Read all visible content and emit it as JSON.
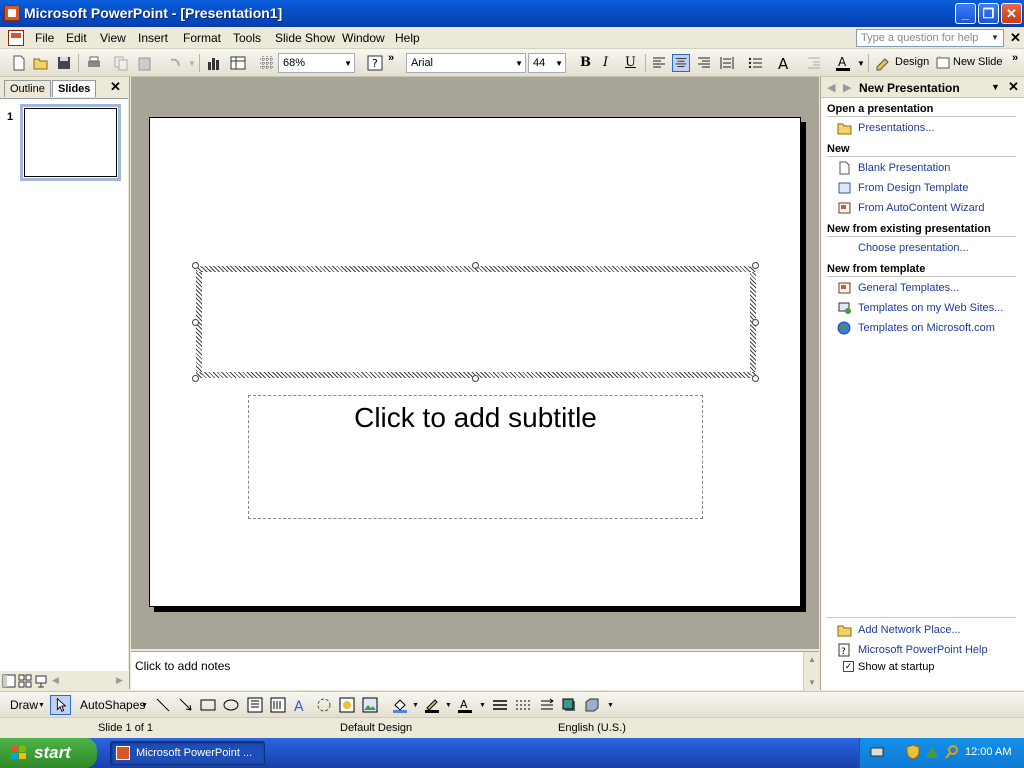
{
  "window": {
    "title": "Microsoft PowerPoint - [Presentation1]"
  },
  "menu": {
    "items": [
      "File",
      "Edit",
      "View",
      "Insert",
      "Format",
      "Tools",
      "Slide Show",
      "Window",
      "Help"
    ],
    "help_placeholder": "Type a question for help"
  },
  "toolbar": {
    "zoom": "68%",
    "font": "Arial",
    "font_size": "44",
    "bold": "B",
    "italic": "I",
    "underline": "U",
    "design_label": "Design",
    "new_slide_label": "New Slide"
  },
  "left_pane": {
    "tabs": [
      "Outline",
      "Slides"
    ],
    "active_tab": "Slides",
    "slide_number": "1"
  },
  "slide": {
    "subtitle_placeholder": "Click to add subtitle"
  },
  "notes": {
    "placeholder": "Click to add notes"
  },
  "task_pane": {
    "title": "New Presentation",
    "sections": {
      "open": {
        "heading": "Open a presentation",
        "links": [
          "Presentations..."
        ]
      },
      "new": {
        "heading": "New",
        "links": [
          "Blank Presentation",
          "From Design Template",
          "From AutoContent Wizard"
        ]
      },
      "existing": {
        "heading": "New from existing presentation",
        "links": [
          "Choose presentation..."
        ]
      },
      "template": {
        "heading": "New from template",
        "links": [
          "General Templates...",
          "Templates on my Web Sites...",
          "Templates on Microsoft.com"
        ]
      }
    },
    "bottom_links": [
      "Add Network Place...",
      "Microsoft PowerPoint Help"
    ],
    "show_at_startup_label": "Show at startup",
    "show_at_startup_checked": true
  },
  "draw_toolbar": {
    "draw_label": "Draw",
    "autoshapes_label": "AutoShapes"
  },
  "status": {
    "slide": "Slide 1 of 1",
    "design": "Default Design",
    "language": "English (U.S.)"
  },
  "taskbar": {
    "start_label": "start",
    "task_label": "Microsoft PowerPoint ...",
    "clock": "12:00 AM"
  },
  "colors": {
    "titlebar_blue": "#0850c8",
    "link_blue": "#1d3c9a",
    "slide_workspace": "#a8a598",
    "start_green": "#3b9a36"
  }
}
